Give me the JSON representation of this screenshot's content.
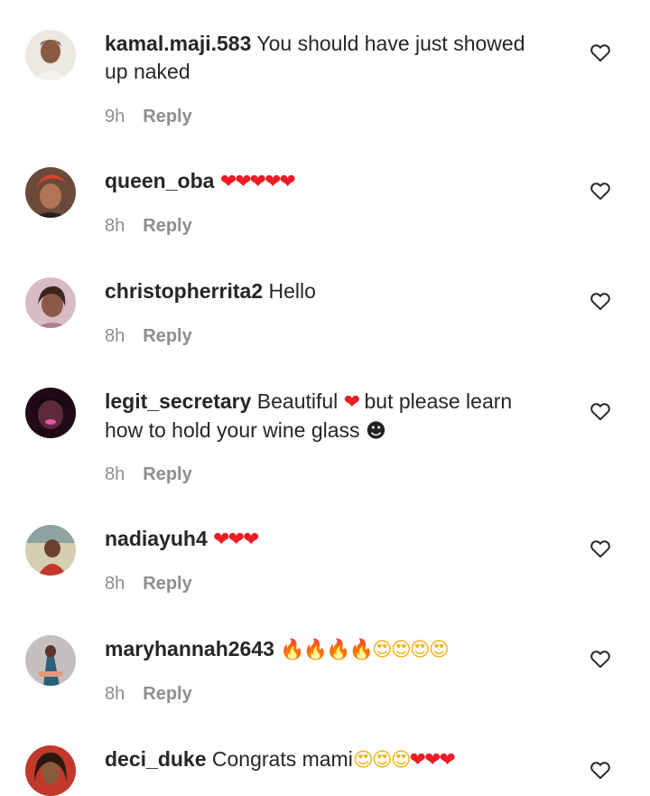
{
  "comments": [
    {
      "username": "kamal.maji.583",
      "text_line1": "You should have just showed",
      "text_line2": "up naked",
      "emoji": "",
      "time": "9h",
      "reply": "Reply",
      "avatar_colors": [
        "#e9e4dc",
        "#3a2a22"
      ]
    },
    {
      "username": "queen_oba",
      "text": "",
      "emoji": "❤❤❤❤❤",
      "time": "8h",
      "reply": "Reply",
      "avatar_colors": [
        "#5a3a2a",
        "#d9542f"
      ]
    },
    {
      "username": "christopherrita2",
      "text": "Hello",
      "emoji": "",
      "time": "8h",
      "reply": "Reply",
      "avatar_colors": [
        "#c9a7b0",
        "#5b3a34"
      ]
    },
    {
      "username": "legit_secretary",
      "text_before": "Beautiful",
      "emoji_mid": "❤",
      "text_after": "but please learn",
      "text_line2": "how to hold your wine glass",
      "emoji_end": "☻",
      "time": "8h",
      "reply": "Reply",
      "avatar_colors": [
        "#2b0f1f",
        "#e04aa0"
      ]
    },
    {
      "username": "nadiayuh4",
      "text": "",
      "emoji": "❤❤❤",
      "time": "8h",
      "reply": "Reply",
      "avatar_colors": [
        "#cfc7a8",
        "#c0392b"
      ]
    },
    {
      "username": "maryhannah2643",
      "text": "",
      "emoji_fire": "🔥🔥🔥🔥",
      "emoji_smile": "😍😍😍😍",
      "time": "8h",
      "reply": "Reply",
      "avatar_colors": [
        "#b9b2b4",
        "#2e5f7a"
      ]
    },
    {
      "username": "deci_duke",
      "text": "Congrats mami",
      "emoji_smile": "😍😍😍",
      "emoji_hearts": "❤❤❤",
      "time": "",
      "reply": "",
      "avatar_colors": [
        "#c0392b",
        "#3b2418"
      ]
    }
  ],
  "icons": {
    "like": "heart-outline-icon"
  },
  "colors": {
    "text": "#262626",
    "meta": "#8e8e8e",
    "heart": "#ed1c24",
    "background": "#ffffff"
  }
}
